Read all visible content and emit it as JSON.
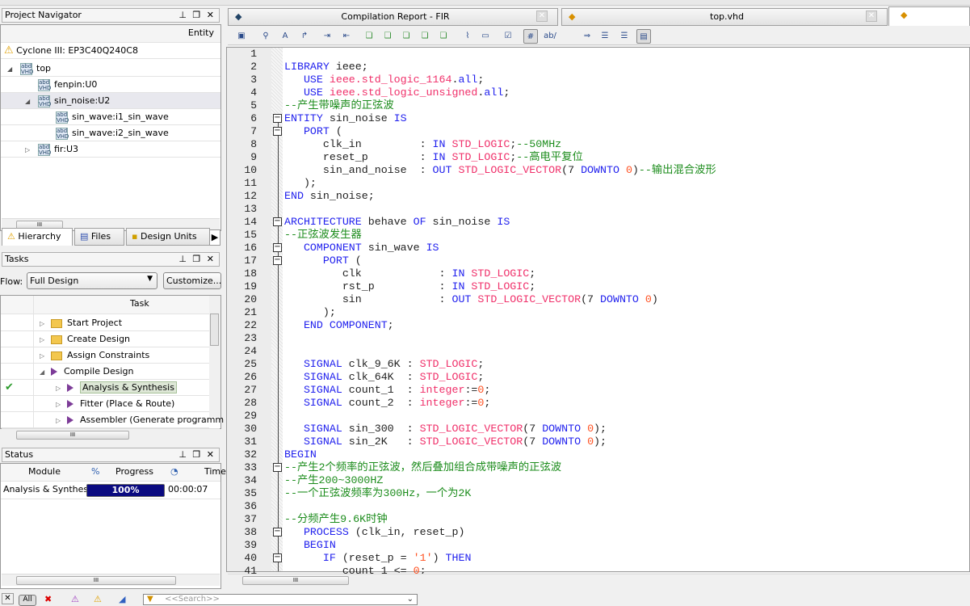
{
  "navigator": {
    "title": "Project Navigator",
    "column": "Entity",
    "device": "Cyclone III: EP3C40Q240C8",
    "items": [
      {
        "label": "top",
        "level": 0,
        "exp": "open"
      },
      {
        "label": "fenpin:U0",
        "level": 1,
        "exp": ""
      },
      {
        "label": "sin_noise:U2",
        "level": 1,
        "exp": "open",
        "selected": true
      },
      {
        "label": "sin_wave:i1_sin_wave",
        "level": 2,
        "exp": ""
      },
      {
        "label": "sin_wave:i2_sin_wave",
        "level": 2,
        "exp": ""
      },
      {
        "label": "fir:U3",
        "level": 1,
        "exp": "closed"
      }
    ],
    "tabs": [
      "Hierarchy",
      "Files",
      "Design Units"
    ]
  },
  "tasks": {
    "title": "Tasks",
    "flow_label": "Flow:",
    "flow_value": "Full Design",
    "customize": "Customize...",
    "column": "Task",
    "items": [
      {
        "label": "Start Project",
        "type": "folder",
        "level": 0
      },
      {
        "label": "Create Design",
        "type": "folder",
        "level": 0
      },
      {
        "label": "Assign Constraints",
        "type": "folder",
        "level": 0
      },
      {
        "label": "Compile Design",
        "type": "run",
        "level": 0,
        "open": true
      },
      {
        "label": "Analysis & Synthesis",
        "type": "run",
        "level": 1,
        "done": true
      },
      {
        "label": "Fitter (Place & Route)",
        "type": "run",
        "level": 1
      },
      {
        "label": "Assembler (Generate programm",
        "type": "run",
        "level": 1
      }
    ]
  },
  "status": {
    "title": "Status",
    "columns": [
      "Module",
      "%",
      "Progress",
      "Time"
    ],
    "rows": [
      {
        "module": "Analysis & Synthesis",
        "progress": "100%",
        "progress_value": 100,
        "time": "00:00:07"
      }
    ]
  },
  "editor_tabs": [
    {
      "label": "Compilation Report - FIR"
    },
    {
      "label": "top.vhd"
    },
    {
      "label": ""
    }
  ],
  "search_placeholder": "<<Search>>",
  "message_filters": [
    "All"
  ],
  "code": {
    "folds": [
      6,
      7,
      14,
      16,
      17,
      33,
      38,
      40
    ],
    "lines": [
      [],
      [
        [
          "k",
          "LIBRARY "
        ],
        [
          "p",
          "ieee;"
        ]
      ],
      [
        [
          "k",
          "   USE "
        ],
        [
          "t",
          "ieee.std_logic_1164"
        ],
        [
          "p",
          "."
        ],
        [
          "k",
          "all"
        ],
        [
          "p",
          ";"
        ]
      ],
      [
        [
          "k",
          "   USE "
        ],
        [
          "t",
          "ieee.std_logic_unsigned"
        ],
        [
          "p",
          "."
        ],
        [
          "k",
          "all"
        ],
        [
          "p",
          ";"
        ]
      ],
      [
        [
          "c",
          "--产生带噪声的正弦波"
        ]
      ],
      [
        [
          "k",
          "ENTITY "
        ],
        [
          "p",
          "sin_noise "
        ],
        [
          "k",
          "IS"
        ]
      ],
      [
        [
          "k",
          "   PORT "
        ],
        [
          "p",
          "("
        ]
      ],
      [
        [
          "p",
          "      clk_in         : "
        ],
        [
          "k",
          "IN "
        ],
        [
          "t",
          "STD_LOGIC"
        ],
        [
          "p",
          ";"
        ],
        [
          "c",
          "--50MHz"
        ]
      ],
      [
        [
          "p",
          "      reset_p        : "
        ],
        [
          "k",
          "IN "
        ],
        [
          "t",
          "STD_LOGIC"
        ],
        [
          "p",
          ";"
        ],
        [
          "c",
          "--高电平复位"
        ]
      ],
      [
        [
          "p",
          "      sin_and_noise  : "
        ],
        [
          "k",
          "OUT "
        ],
        [
          "t",
          "STD_LOGIC_VECTOR"
        ],
        [
          "p",
          "(7 "
        ],
        [
          "k",
          "DOWNTO "
        ],
        [
          "n",
          "0"
        ],
        [
          "p",
          ")"
        ],
        [
          "c",
          "--输出混合波形"
        ]
      ],
      [
        [
          "p",
          "   );"
        ]
      ],
      [
        [
          "k",
          "END "
        ],
        [
          "p",
          "sin_noise;"
        ]
      ],
      [],
      [
        [
          "k",
          "ARCHITECTURE "
        ],
        [
          "p",
          "behave "
        ],
        [
          "k",
          "OF "
        ],
        [
          "p",
          "sin_noise "
        ],
        [
          "k",
          "IS"
        ]
      ],
      [
        [
          "c",
          "--正弦波发生器"
        ]
      ],
      [
        [
          "k",
          "   COMPONENT "
        ],
        [
          "p",
          "sin_wave "
        ],
        [
          "k",
          "IS"
        ]
      ],
      [
        [
          "k",
          "      PORT "
        ],
        [
          "p",
          "("
        ]
      ],
      [
        [
          "p",
          "         clk            : "
        ],
        [
          "k",
          "IN "
        ],
        [
          "t",
          "STD_LOGIC"
        ],
        [
          "p",
          ";"
        ]
      ],
      [
        [
          "p",
          "         rst_p          : "
        ],
        [
          "k",
          "IN "
        ],
        [
          "t",
          "STD_LOGIC"
        ],
        [
          "p",
          ";"
        ]
      ],
      [
        [
          "p",
          "         sin            : "
        ],
        [
          "k",
          "OUT "
        ],
        [
          "t",
          "STD_LOGIC_VECTOR"
        ],
        [
          "p",
          "(7 "
        ],
        [
          "k",
          "DOWNTO "
        ],
        [
          "n",
          "0"
        ],
        [
          "p",
          ")"
        ]
      ],
      [
        [
          "p",
          "      );"
        ]
      ],
      [
        [
          "k",
          "   END COMPONENT"
        ],
        [
          "p",
          ";"
        ]
      ],
      [],
      [],
      [
        [
          "k",
          "   SIGNAL "
        ],
        [
          "p",
          "clk_9_6K : "
        ],
        [
          "t",
          "STD_LOGIC"
        ],
        [
          "p",
          ";"
        ]
      ],
      [
        [
          "k",
          "   SIGNAL "
        ],
        [
          "p",
          "clk_64K  : "
        ],
        [
          "t",
          "STD_LOGIC"
        ],
        [
          "p",
          ";"
        ]
      ],
      [
        [
          "k",
          "   SIGNAL "
        ],
        [
          "p",
          "count_1  : "
        ],
        [
          "t",
          "integer"
        ],
        [
          "p",
          ":="
        ],
        [
          "n",
          "0"
        ],
        [
          "p",
          ";"
        ]
      ],
      [
        [
          "k",
          "   SIGNAL "
        ],
        [
          "p",
          "count_2  : "
        ],
        [
          "t",
          "integer"
        ],
        [
          "p",
          ":="
        ],
        [
          "n",
          "0"
        ],
        [
          "p",
          ";"
        ]
      ],
      [],
      [
        [
          "k",
          "   SIGNAL "
        ],
        [
          "p",
          "sin_300  : "
        ],
        [
          "t",
          "STD_LOGIC_VECTOR"
        ],
        [
          "p",
          "(7 "
        ],
        [
          "k",
          "DOWNTO "
        ],
        [
          "n",
          "0"
        ],
        [
          "p",
          ");"
        ]
      ],
      [
        [
          "k",
          "   SIGNAL "
        ],
        [
          "p",
          "sin_2K   : "
        ],
        [
          "t",
          "STD_LOGIC_VECTOR"
        ],
        [
          "p",
          "(7 "
        ],
        [
          "k",
          "DOWNTO "
        ],
        [
          "n",
          "0"
        ],
        [
          "p",
          ");"
        ]
      ],
      [
        [
          "k",
          "BEGIN"
        ]
      ],
      [
        [
          "c",
          "--产生2个频率的正弦波，然后叠加组合成带噪声的正弦波"
        ]
      ],
      [
        [
          "c",
          "--产生200~3000HZ"
        ]
      ],
      [
        [
          "c",
          "--一个正弦波频率为300Hz，一个为2K"
        ]
      ],
      [],
      [
        [
          "c",
          "--分频产生9.6K时钟"
        ]
      ],
      [
        [
          "k",
          "   PROCESS "
        ],
        [
          "p",
          "(clk_in, reset_p)"
        ]
      ],
      [
        [
          "k",
          "   BEGIN"
        ]
      ],
      [
        [
          "k",
          "      IF "
        ],
        [
          "p",
          "(reset_p = "
        ],
        [
          "n",
          "'1'"
        ],
        [
          "p",
          ") "
        ],
        [
          "k",
          "THEN"
        ]
      ],
      [
        [
          "p",
          "         count_1 <= "
        ],
        [
          "n",
          "0"
        ],
        [
          "p",
          ";"
        ]
      ]
    ]
  }
}
